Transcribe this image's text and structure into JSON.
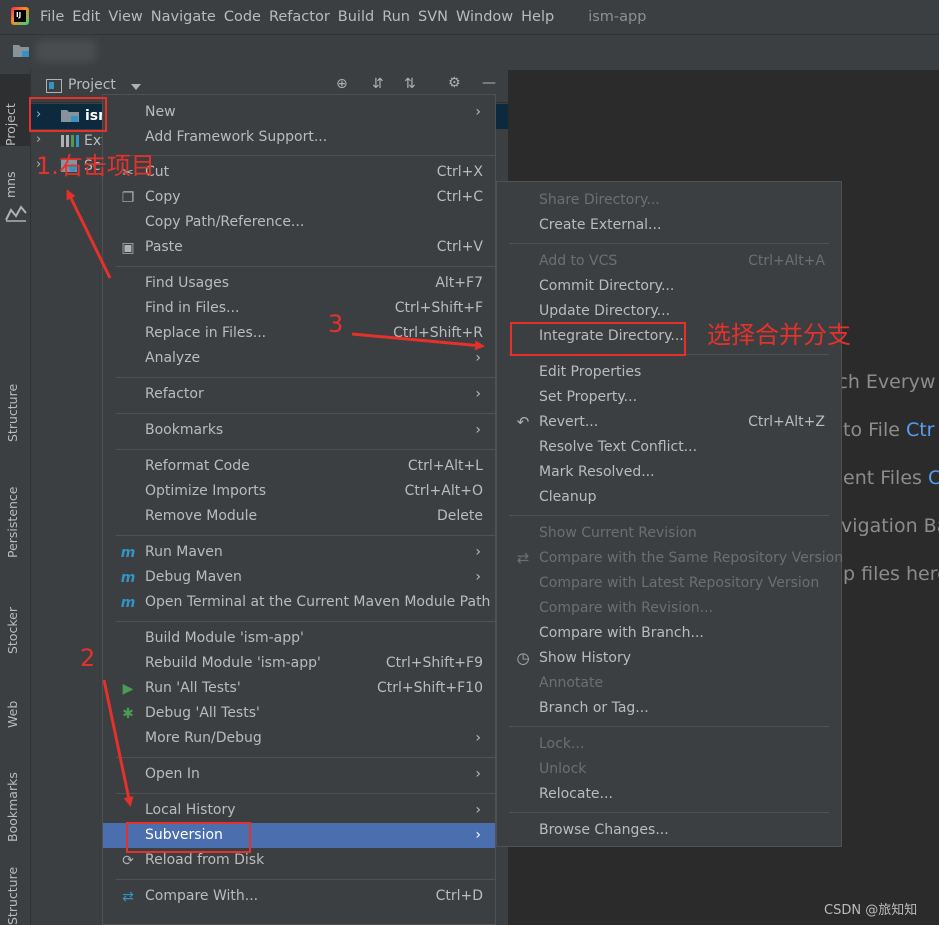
{
  "menubar": {
    "items": [
      "File",
      "Edit",
      "View",
      "Navigate",
      "Code",
      "Refactor",
      "Build",
      "Run",
      "SVN",
      "Window",
      "Help"
    ],
    "window_title": "ism-app"
  },
  "left_strip": {
    "tabs": [
      "Project",
      "mns",
      "Structure",
      "Persistence",
      "Stocker",
      "Web",
      "Bookmarks",
      "Structure"
    ]
  },
  "project_panel": {
    "title": "Project",
    "tree": [
      {
        "label": "ism"
      },
      {
        "label": "Ext"
      },
      {
        "label": "Sc"
      }
    ]
  },
  "context_menu": {
    "items": [
      {
        "label": "New",
        "submenu": true,
        "icon": ""
      },
      {
        "label": "Add Framework Support...",
        "icon": ""
      },
      {
        "label": "Cut",
        "shortcut": "Ctrl+X",
        "icon": "scissors-icon"
      },
      {
        "label": "Copy",
        "shortcut": "Ctrl+C",
        "icon": "copy-icon"
      },
      {
        "label": "Copy Path/Reference...",
        "icon": ""
      },
      {
        "label": "Paste",
        "shortcut": "Ctrl+V",
        "icon": "clipboard-icon"
      },
      {
        "label": "Find Usages",
        "shortcut": "Alt+F7",
        "icon": ""
      },
      {
        "label": "Find in Files...",
        "shortcut": "Ctrl+Shift+F",
        "icon": ""
      },
      {
        "label": "Replace in Files...",
        "shortcut": "Ctrl+Shift+R",
        "icon": ""
      },
      {
        "label": "Analyze",
        "submenu": true,
        "icon": ""
      },
      {
        "label": "Refactor",
        "submenu": true,
        "icon": ""
      },
      {
        "label": "Bookmarks",
        "submenu": true,
        "icon": ""
      },
      {
        "label": "Reformat Code",
        "shortcut": "Ctrl+Alt+L",
        "icon": ""
      },
      {
        "label": "Optimize Imports",
        "shortcut": "Ctrl+Alt+O",
        "icon": ""
      },
      {
        "label": "Remove Module",
        "shortcut": "Delete",
        "icon": ""
      },
      {
        "label": "Run Maven",
        "submenu": true,
        "icon": "maven-run-icon"
      },
      {
        "label": "Debug Maven",
        "submenu": true,
        "icon": "maven-debug-icon"
      },
      {
        "label": "Open Terminal at the Current Maven Module Path",
        "icon": "terminal-icon"
      },
      {
        "label": "Build Module 'ism-app'",
        "icon": ""
      },
      {
        "label": "Rebuild Module 'ism-app'",
        "shortcut": "Ctrl+Shift+F9",
        "icon": ""
      },
      {
        "label": "Run 'All Tests'",
        "shortcut": "Ctrl+Shift+F10",
        "icon": "run-icon"
      },
      {
        "label": "Debug 'All Tests'",
        "icon": "debug-icon"
      },
      {
        "label": "More Run/Debug",
        "submenu": true,
        "icon": ""
      },
      {
        "label": "Open In",
        "submenu": true,
        "icon": ""
      },
      {
        "label": "Local History",
        "submenu": true,
        "icon": ""
      },
      {
        "label": "Subversion",
        "submenu": true,
        "selected": true,
        "icon": ""
      },
      {
        "label": "Reload from Disk",
        "icon": "reload-icon"
      },
      {
        "label": "Compare With...",
        "shortcut": "Ctrl+D",
        "icon": "compare-icon"
      }
    ]
  },
  "submenu": {
    "items": [
      {
        "label": "Share Directory...",
        "disabled": true
      },
      {
        "label": "Create External..."
      },
      {
        "label": "Add to VCS",
        "shortcut": "Ctrl+Alt+A",
        "disabled": true
      },
      {
        "label": "Commit Directory..."
      },
      {
        "label": "Update Directory..."
      },
      {
        "label": "Integrate Directory..."
      },
      {
        "label": "Edit Properties"
      },
      {
        "label": "Set Property..."
      },
      {
        "label": "Revert...",
        "shortcut": "Ctrl+Alt+Z",
        "icon": "revert-icon"
      },
      {
        "label": "Resolve Text Conflict..."
      },
      {
        "label": "Mark Resolved..."
      },
      {
        "label": "Cleanup"
      },
      {
        "label": "Show Current Revision",
        "disabled": true
      },
      {
        "label": "Compare with the Same Repository Version",
        "disabled": true,
        "icon": "compare-icon"
      },
      {
        "label": "Compare with Latest Repository Version",
        "disabled": true
      },
      {
        "label": "Compare with Revision...",
        "disabled": true
      },
      {
        "label": "Compare with Branch..."
      },
      {
        "label": "Show History",
        "icon": "clock-icon"
      },
      {
        "label": "Annotate",
        "disabled": true
      },
      {
        "label": "Branch or Tag..."
      },
      {
        "label": "Lock...",
        "disabled": true
      },
      {
        "label": "Unlock",
        "disabled": true
      },
      {
        "label": "Relocate..."
      },
      {
        "label": "Browse Changes..."
      }
    ]
  },
  "editor_hints": [
    {
      "text": "rch Everyw",
      "key": ""
    },
    {
      "text": "to File ",
      "key": "Ctr"
    },
    {
      "text": "ent Files ",
      "key": "C"
    },
    {
      "text": "vigation Ba",
      "key": ""
    },
    {
      "text": "p files here",
      "key": ""
    }
  ],
  "annotations": {
    "step1": "1.右击项目",
    "step2": "2",
    "step3": "3",
    "step3_note": "选择合并分支",
    "color": "#e5312b"
  },
  "watermark": "CSDN @旅知知",
  "colors": {
    "selection": "#4b6eaf",
    "menu_bg": "#3c3f41",
    "editor_bg": "#2b2b2b"
  }
}
